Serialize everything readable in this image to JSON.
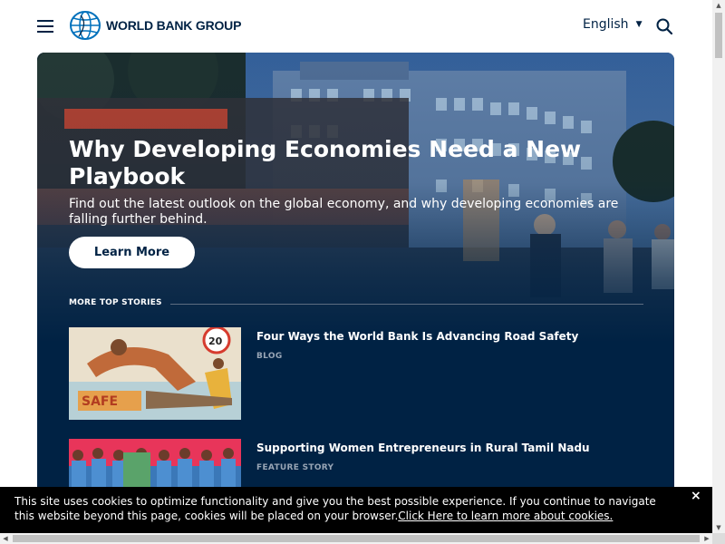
{
  "header": {
    "logo_text": "WORLD BANK GROUP",
    "language": "English"
  },
  "hero": {
    "title": "Why Developing Economies Need a New Playbook",
    "subtitle": "Find out the latest outlook on the global economy, and why developing economies are falling further behind.",
    "button_label": "Learn More"
  },
  "top_stories": {
    "heading": "MORE TOP STORIES",
    "items": [
      {
        "title": "Four Ways the World Bank Is Advancing Road Safety",
        "tag": "BLOG"
      },
      {
        "title": "Supporting Women Entrepreneurs in Rural Tamil Nadu",
        "tag": "FEATURE STORY"
      }
    ]
  },
  "cookie": {
    "text": "This site uses cookies to optimize functionality and give you the best possible experience. If you continue to navigate this website beyond this page, cookies will be placed on your browser.",
    "link_text": "Click Here to learn more about cookies.",
    "close": "×"
  },
  "colors": {
    "brand": "#002244",
    "page_background": "#ffffff",
    "cookie_background": "#000000"
  },
  "icons": [
    "hamburger-icon",
    "globe-icon",
    "chevron-down-icon",
    "search-icon",
    "close-icon"
  ]
}
